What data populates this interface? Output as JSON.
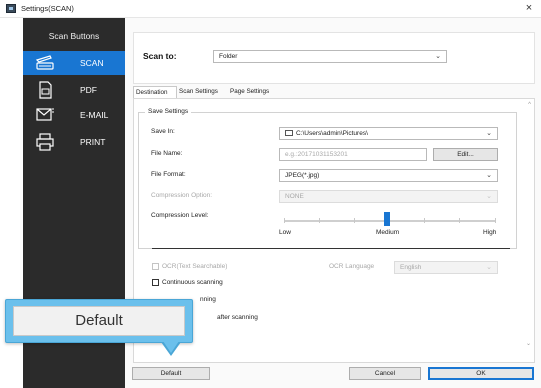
{
  "window": {
    "title": "Settings(SCAN)",
    "close_glyph": "×",
    "icon": "scanner-app-icon"
  },
  "sidebar": {
    "title": "Scan Buttons",
    "items": [
      {
        "label": "SCAN",
        "icon": "scanner-icon",
        "active": true
      },
      {
        "label": "PDF",
        "icon": "pdf-document-icon",
        "active": false
      },
      {
        "label": "E-MAIL",
        "icon": "email-icon",
        "active": false
      },
      {
        "label": "PRINT",
        "icon": "printer-icon",
        "active": false
      }
    ]
  },
  "scan_to": {
    "label": "Scan to:",
    "value": "Folder"
  },
  "tabs": [
    {
      "label": "Destination",
      "active": true
    },
    {
      "label": "Scan Settings",
      "active": false
    },
    {
      "label": "Page Settings",
      "active": false
    }
  ],
  "save_settings": {
    "legend": "Save Settings",
    "save_in": {
      "label": "Save In:",
      "value": "C:\\Users\\admin\\Pictures\\"
    },
    "file_name": {
      "label": "File Name:",
      "placeholder": "e.g.:20171031153201",
      "edit_label": "Edit..."
    },
    "file_format": {
      "label": "File Format:",
      "value": "JPEG(*.jpg)"
    },
    "compression_option": {
      "label": "Compression Option:",
      "value": "NONE",
      "disabled": true
    },
    "compression_level": {
      "label": "Compression Level:",
      "low": "Low",
      "medium": "Medium",
      "high": "High",
      "level": 0.5
    }
  },
  "options": {
    "ocr": {
      "label": "OCR(Text Searchable)",
      "disabled": true
    },
    "ocr_language": {
      "label": "OCR Language",
      "value": "English",
      "disabled": true
    },
    "continuous": {
      "label": "Continuous scanning"
    },
    "partial_after": {
      "label": "nning"
    },
    "partial_after2": {
      "label": "after scanning"
    }
  },
  "callout": {
    "label": "Default"
  },
  "footer": {
    "default_label": "Default",
    "cancel_label": "Cancel",
    "ok_label": "OK"
  },
  "colors": {
    "accent": "#1976d2",
    "sidebar_bg": "#2b2b2b",
    "callout_border": "#4aa6d6",
    "callout_fill": "#6bc0ec"
  }
}
